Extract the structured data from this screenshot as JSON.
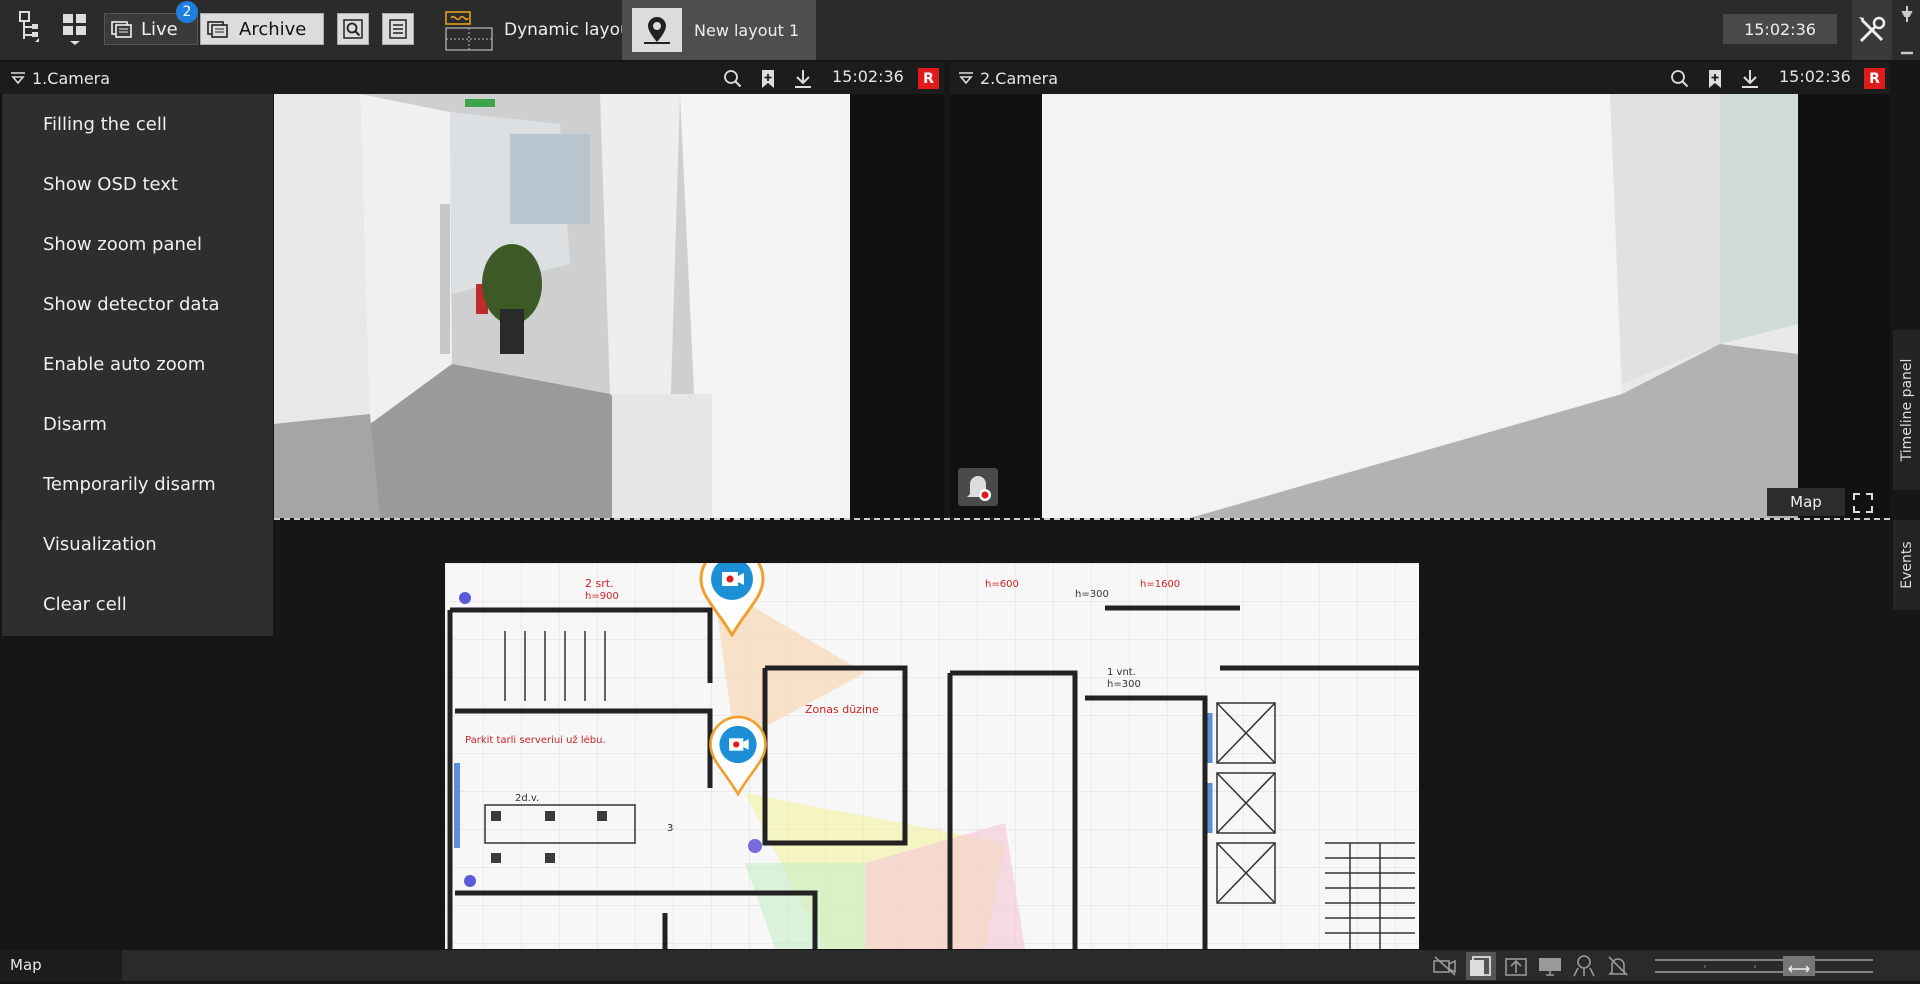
{
  "toolbar": {
    "live_label": "Live",
    "live_badge": "2",
    "archive_label": "Archive",
    "dynamic_layout_label": "Dynamic layout",
    "new_layout_label": "New layout 1",
    "clock": "15:02:36"
  },
  "cameras": [
    {
      "title": "1.Camera",
      "time": "15:02:36",
      "rec": "R"
    },
    {
      "title": "2.Camera",
      "time": "15:02:36",
      "rec": "R"
    }
  ],
  "context_menu": {
    "items": [
      "Filling the cell",
      "Show OSD text",
      "Show zoom panel",
      "Show detector data",
      "Enable auto zoom",
      "Disarm",
      "Temporarily disarm",
      "Visualization",
      "Clear cell"
    ]
  },
  "cell2": {
    "map_button": "Map"
  },
  "side_tabs": {
    "timeline": "Timeline panel",
    "events": "Events"
  },
  "bottom": {
    "label": "Map"
  },
  "map": {
    "texts": {
      "t1": "2 srt.",
      "t2": "h=900",
      "t3": "h=600",
      "t4": "h=1600",
      "t5": "h=300",
      "t6": "1 vnt.",
      "t7": "h=300",
      "t8": "Parkit tarli serveriui už lėbu.",
      "t9": "Zonas dūzine",
      "t10": "2d.v.",
      "t11": "3"
    }
  }
}
